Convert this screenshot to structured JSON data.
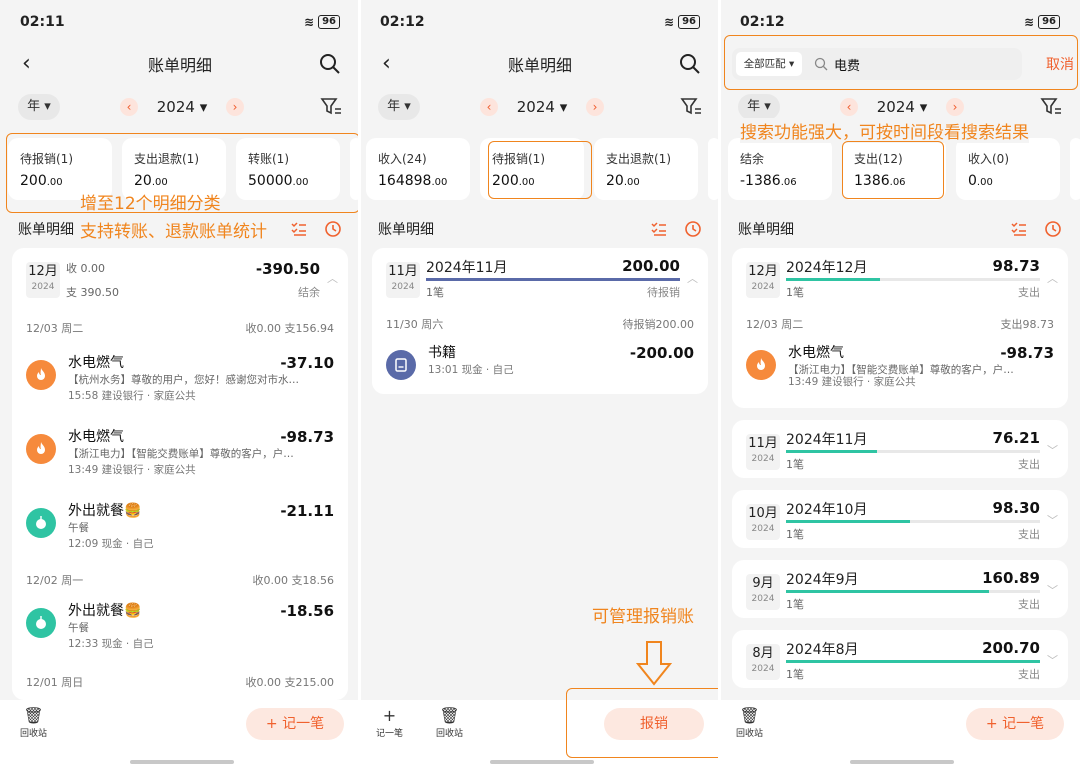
{
  "screens": [
    {
      "status": {
        "time": "02:11",
        "battery": "96"
      },
      "nav": {
        "title": "账单明细"
      },
      "filter": {
        "period": "年",
        "year": "2024"
      },
      "cards": [
        {
          "label": "待报销(1)",
          "int": "200",
          "dec": ".00"
        },
        {
          "label": "支出退款(1)",
          "int": "20",
          "dec": ".00"
        },
        {
          "label": "转账(1)",
          "int": "50000",
          "dec": ".00"
        }
      ],
      "card_annotation": "增至12个明细分类",
      "section": {
        "title": "账单明细",
        "annotation": "支持转账、退款账单统计"
      },
      "month": {
        "m": "12月",
        "y": "2024",
        "income": "收 0.00",
        "expense": "支 390.50",
        "amount": "-390.50",
        "balance_label": "结余"
      },
      "days": [
        {
          "date": "12/03 周二",
          "summary": "收0.00 支156.94"
        },
        {
          "date": "12/02 周一",
          "summary": "收0.00 支18.56"
        },
        {
          "date": "12/01 周日",
          "summary": "收0.00 支215.00"
        }
      ],
      "entries": [
        {
          "name": "水电燃气",
          "amount": "-37.10",
          "note": "【杭州水务】尊敬的用户，您好！感谢您对市水…",
          "meta": "15:58 建设银行 · 家庭公共"
        },
        {
          "name": "水电燃气",
          "amount": "-98.73",
          "note": "【浙江电力】【智能交费账单】尊敬的客户，户…",
          "meta": "13:49 建设银行 · 家庭公共"
        },
        {
          "name": "外出就餐🍔",
          "amount": "-21.11",
          "note": "午餐",
          "meta": "12:09 现金 · 自己"
        },
        {
          "name": "外出就餐🍔",
          "amount": "-18.56",
          "note": "午餐",
          "meta": "12:33 现金 · 自己"
        }
      ],
      "bottom": {
        "trash": "回收站",
        "add": "+ 记一笔"
      }
    },
    {
      "status": {
        "time": "02:12",
        "battery": "96"
      },
      "nav": {
        "title": "账单明细"
      },
      "filter": {
        "period": "年",
        "year": "2024"
      },
      "cards": [
        {
          "label": "收入(24)",
          "int": "164898",
          "dec": ".00"
        },
        {
          "label": "待报销(1)",
          "int": "200",
          "dec": ".00"
        },
        {
          "label": "支出退款(1)",
          "int": "20",
          "dec": ".00"
        }
      ],
      "section": {
        "title": "账单明细"
      },
      "month": {
        "m": "11月",
        "y": "2024",
        "title": "2024年11月",
        "amount": "200.00",
        "count": "1笔",
        "status": "待报销"
      },
      "day": {
        "date": "11/30 周六",
        "summary": "待报销200.00"
      },
      "entry": {
        "name": "书籍",
        "amount": "-200.00",
        "meta": "13:01 现金 · 自己"
      },
      "annotation": "可管理报销账",
      "bottom": {
        "add_label": "记一笔",
        "trash": "回收站",
        "reimburse": "报销"
      }
    },
    {
      "status": {
        "time": "02:12",
        "battery": "96"
      },
      "search": {
        "match": "全部匹配 ▾",
        "query": "电费",
        "cancel": "取消"
      },
      "annotation": "搜索功能强大，可按时间段看搜索结果",
      "filter": {
        "period": "年",
        "year": "2024"
      },
      "cards": [
        {
          "label": "结余",
          "int": "-1386",
          "dec": ".06"
        },
        {
          "label": "支出(12)",
          "int": "1386",
          "dec": ".06"
        },
        {
          "label": "收入(0)",
          "int": "0",
          "dec": ".00"
        }
      ],
      "section": {
        "title": "账单明细"
      },
      "dec_month": {
        "m": "12月",
        "y": "2024",
        "title": "2024年12月",
        "amount": "98.73",
        "count": "1笔",
        "type": "支出",
        "fill": 0.37
      },
      "day": {
        "date": "12/03 周二",
        "summary": "支出98.73"
      },
      "entry": {
        "name": "水电燃气",
        "amount": "-98.73",
        "note": "【浙江电力】【智能交费账单】尊敬的客户，户…",
        "meta": "13:49 建设银行 · 家庭公共"
      },
      "months": [
        {
          "m": "11月",
          "y": "2024",
          "title": "2024年11月",
          "amount": "76.21",
          "count": "1笔",
          "type": "支出",
          "fill": 0.36
        },
        {
          "m": "10月",
          "y": "2024",
          "title": "2024年10月",
          "amount": "98.30",
          "count": "1笔",
          "type": "支出",
          "fill": 0.49
        },
        {
          "m": "9月",
          "y": "2024",
          "title": "2024年9月",
          "amount": "160.89",
          "count": "1笔",
          "type": "支出",
          "fill": 0.8
        },
        {
          "m": "8月",
          "y": "2024",
          "title": "2024年8月",
          "amount": "200.70",
          "count": "1笔",
          "type": "支出",
          "fill": 1.0
        }
      ],
      "bottom": {
        "trash": "回收站",
        "add": "+ 记一笔"
      }
    }
  ],
  "colors": {
    "accent": "#f0612e",
    "highlight": "#f0851e",
    "green": "#2fc4a3",
    "navy": "#5a6aa8"
  }
}
